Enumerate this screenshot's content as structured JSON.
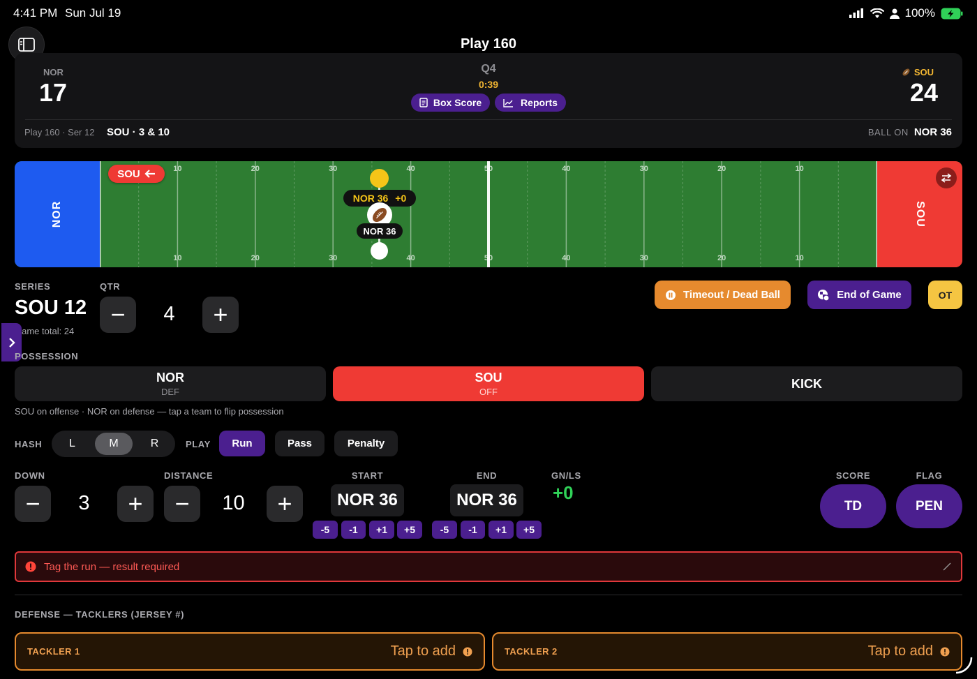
{
  "status_bar": {
    "time": "4:41 PM",
    "date": "Sun Jul 19",
    "battery": "100%"
  },
  "header": {
    "title": "Play 160"
  },
  "scoreboard": {
    "home_abbr": "NOR",
    "home_score": "17",
    "away_abbr": "SOU",
    "away_score": "24",
    "quarter": "Q4",
    "clock": "0:39",
    "box_score_label": "Box Score",
    "reports_label": "Reports",
    "play_info": "Play 160 · Ser 12",
    "situation": "SOU · 3 & 10",
    "ball_on_label": "BALL ON",
    "ball_on_value": "NOR 36"
  },
  "field": {
    "left_endzone": "NOR",
    "right_endzone": "SOU",
    "direction_badge": "SOU",
    "yard_numbers_top": [
      "10",
      "20",
      "30",
      "40",
      "50",
      "40",
      "30",
      "20",
      "10"
    ],
    "yard_numbers_bottom": [
      "10",
      "20",
      "30",
      "40",
      "50",
      "40",
      "30",
      "20",
      "10"
    ],
    "ball_tag_pos": "NOR 36",
    "ball_tag_gain": "+0",
    "spot_tag": "NOR 36",
    "ball_yard_fraction": 0.36,
    "colors": {
      "home": "#1e5bf0",
      "away": "#ef3a34",
      "turf": "#2e7d32"
    }
  },
  "controls": {
    "series_label": "SERIES",
    "series_value": "SOU 12",
    "game_total": "Game total: 24",
    "qtr_label": "QTR",
    "qtr_value": "4",
    "timeout_label": "Timeout / Dead Ball",
    "end_game_label": "End of Game",
    "ot_label": "OT",
    "possession_label": "POSSESSION",
    "poss_home": "NOR",
    "poss_home_role": "DEF",
    "poss_away": "SOU",
    "poss_away_role": "OFF",
    "kick_label": "KICK",
    "possession_hint": "SOU on offense · NOR on defense — tap a team to flip possession",
    "hash_label": "HASH",
    "hash_options": [
      "L",
      "M",
      "R"
    ],
    "hash_selected": "M",
    "play_label": "PLAY",
    "play_run": "Run",
    "play_pass": "Pass",
    "play_penalty": "Penalty",
    "down_label": "DOWN",
    "down_value": "3",
    "distance_label": "DISTANCE",
    "distance_value": "10",
    "start_label": "START",
    "start_value": "NOR 36",
    "end_label": "END",
    "end_value": "NOR 36",
    "adjust": [
      "-5",
      "-1",
      "+1",
      "+5"
    ],
    "gnls_label": "GN/LS",
    "gnls_value": "+0",
    "score_label": "SCORE",
    "score_btn": "TD",
    "flag_label": "FLAG",
    "flag_btn": "PEN",
    "alert_text": "Tag the run — result required",
    "defense_label": "DEFENSE — TACKLERS (JERSEY #)",
    "tackler1_label": "TACKLER 1",
    "tackler2_label": "TACKLER 2",
    "tap_to_add": "Tap to add"
  }
}
